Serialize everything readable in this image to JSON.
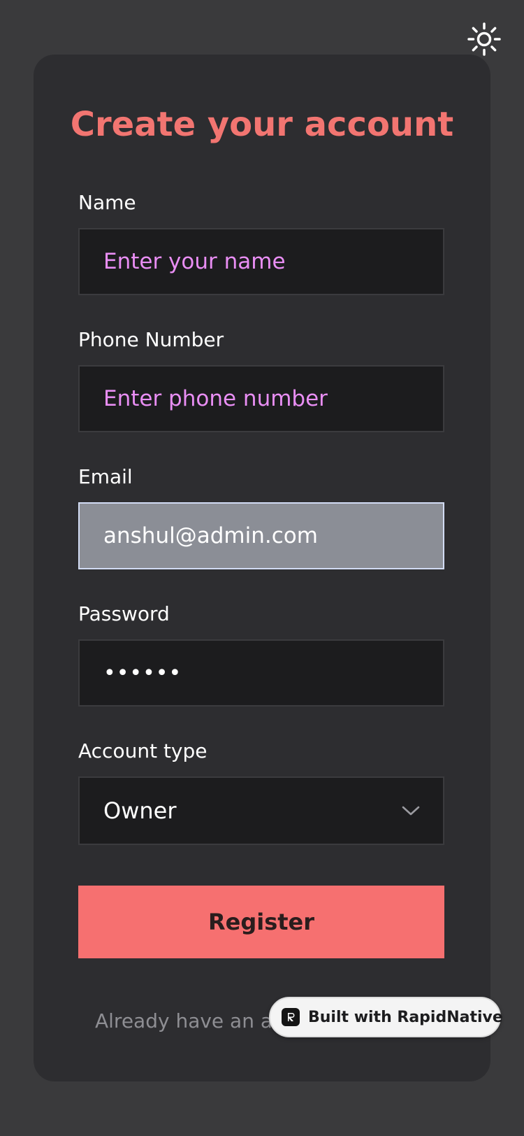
{
  "header": {
    "theme_toggle_icon": "sun-icon"
  },
  "form": {
    "title": "Create your account",
    "name": {
      "label": "Name",
      "placeholder": "Enter your name",
      "value": ""
    },
    "phone": {
      "label": "Phone Number",
      "placeholder": "Enter phone number",
      "value": ""
    },
    "email": {
      "label": "Email",
      "value": "anshul@admin.com"
    },
    "password": {
      "label": "Password",
      "value": "••••••"
    },
    "account_type": {
      "label": "Account type",
      "selected": "Owner",
      "icon": "chevron-down-icon"
    },
    "register_label": "Register"
  },
  "footer": {
    "prefix": "Already have an acc"
  },
  "badge": {
    "text": "Built with RapidNative",
    "icon": "rapidnative-logo-icon"
  },
  "colors": {
    "page_background": "#3a3a3c",
    "card_background": "#2d2d30",
    "accent": "#f27571",
    "button": "#f67070",
    "placeholder": "#e98ef4",
    "input_background": "#1c1c1e",
    "input_focused_background": "#8b8e96"
  }
}
